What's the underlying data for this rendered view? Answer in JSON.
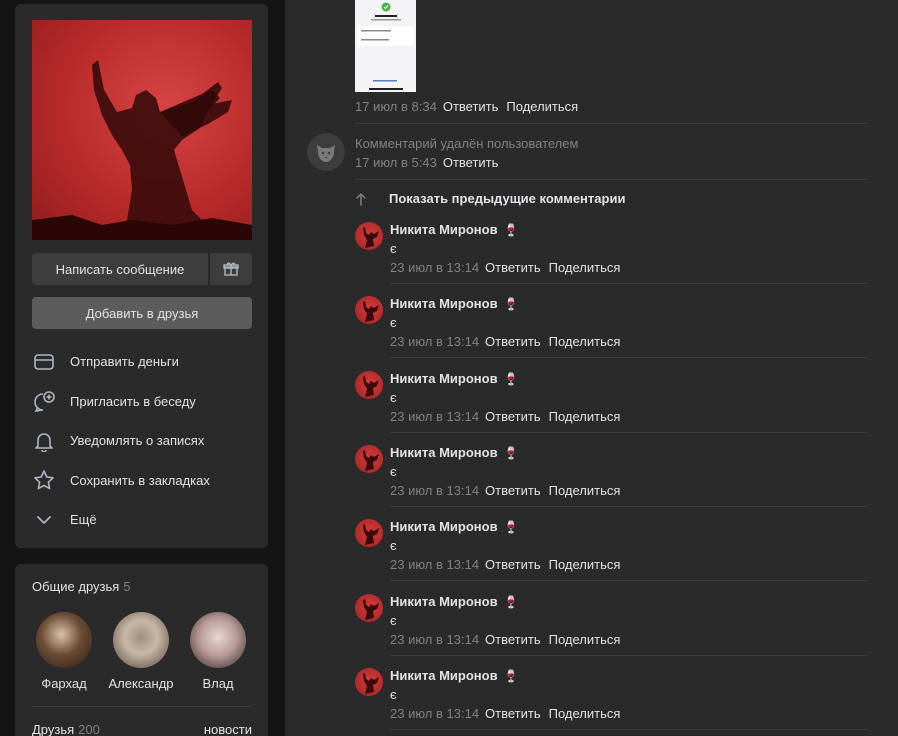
{
  "profile": {
    "write_message": "Написать сообщение",
    "add_friend": "Добавить в друзья"
  },
  "menu": [
    {
      "label": "Отправить деньги",
      "icon": "card-icon"
    },
    {
      "label": "Пригласить в беседу",
      "icon": "chat-plus-icon"
    },
    {
      "label": "Уведомлять о записях",
      "icon": "bell-icon"
    },
    {
      "label": "Сохранить в закладках",
      "icon": "star-icon"
    },
    {
      "label": "Ещё",
      "icon": "chevron-down-icon"
    }
  ],
  "mutual_friends": {
    "title": "Общие друзья",
    "count": "5",
    "people": [
      {
        "name": "Фархад"
      },
      {
        "name": "Александр"
      },
      {
        "name": "Влад"
      }
    ]
  },
  "friends": {
    "title": "Друзья",
    "count": "200",
    "news_link": "новости"
  },
  "feed": {
    "top_meta": {
      "time": "17 июл в 8:34",
      "reply": "Ответить",
      "share": "Поделиться"
    },
    "deleted": {
      "text": "Комментарий удалён пользователем",
      "time": "17 июл в 5:43",
      "reply": "Ответить"
    },
    "show_prev": "Показать предыдущие комментарии",
    "replies": [
      {
        "author": "Никита Миронов",
        "emoji": "🍷",
        "text": "є",
        "time": "23 июл в 13:14",
        "reply": "Ответить",
        "share": "Поделиться"
      },
      {
        "author": "Никита Миронов",
        "emoji": "🍷",
        "text": "є",
        "time": "23 июл в 13:14",
        "reply": "Ответить",
        "share": "Поделиться"
      },
      {
        "author": "Никита Миронов",
        "emoji": "🍷",
        "text": "є",
        "time": "23 июл в 13:14",
        "reply": "Ответить",
        "share": "Поделиться"
      },
      {
        "author": "Никита Миронов",
        "emoji": "🍷",
        "text": "є",
        "time": "23 июл в 13:14",
        "reply": "Ответить",
        "share": "Поделиться"
      },
      {
        "author": "Никита Миронов",
        "emoji": "🍷",
        "text": "є",
        "time": "23 июл в 13:14",
        "reply": "Ответить",
        "share": "Поделиться"
      },
      {
        "author": "Никита Миронов",
        "emoji": "🍷",
        "text": "є",
        "time": "23 июл в 13:14",
        "reply": "Ответить",
        "share": "Поделиться"
      },
      {
        "author": "Никита Миронов",
        "emoji": "🍷",
        "text": "є",
        "time": "23 июл в 13:14",
        "reply": "Ответить",
        "share": "Поделиться"
      }
    ]
  }
}
